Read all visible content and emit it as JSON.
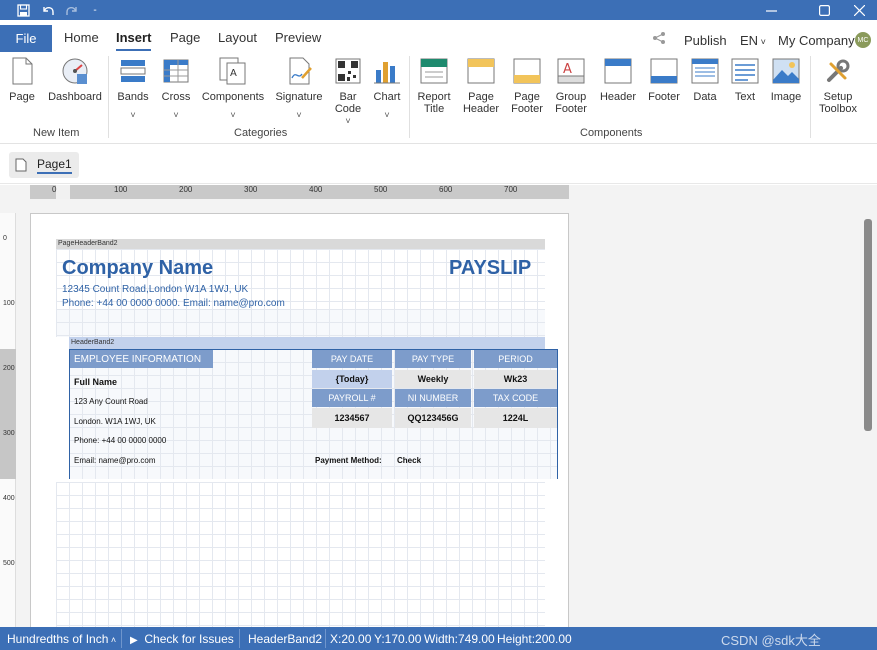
{
  "titlebar": {
    "save_icon": "save-icon",
    "undo_icon": "undo-icon",
    "redo_icon": "redo-icon",
    "separator": "-"
  },
  "tabs": {
    "file": "File",
    "items": [
      "Home",
      "Insert",
      "Page",
      "Layout",
      "Preview"
    ],
    "active": "Insert",
    "publish": "Publish",
    "language": "EN",
    "company": "My Company",
    "avatar": "MC"
  },
  "ribbon": {
    "new_item": {
      "label": "New Item",
      "items": [
        "Page",
        "Dashboard"
      ]
    },
    "categories": {
      "label": "Categories",
      "items": [
        "Bands",
        "Cross",
        "Components",
        "Signature",
        "Bar",
        "Code",
        "Chart"
      ]
    },
    "components": {
      "label": "Components",
      "items": [
        "Report",
        "Title",
        "Page",
        "Header",
        "Page",
        "Footer",
        "Group",
        "Footer",
        "Header",
        "Footer",
        "Data",
        "Text",
        "Image"
      ]
    },
    "setup": {
      "items": [
        "Setup",
        "Toolbox"
      ]
    }
  },
  "pagetab": {
    "label": "Page1"
  },
  "ruler": {
    "h_ticks": [
      "0",
      "100",
      "200",
      "300",
      "400",
      "500",
      "600",
      "700"
    ],
    "v_ticks": [
      "0",
      "100",
      "200",
      "300",
      "400",
      "500"
    ]
  },
  "report": {
    "page_header_band": "PageHeaderBand2",
    "header_band": "HeaderBand2",
    "company": "Company Name",
    "title": "PAYSLIP",
    "address": "12345 Count Road,London W1A 1WJ, UK",
    "contact": "Phone: +44 00 0000 0000. Email: name@pro.com",
    "employee": {
      "header": "EMPLOYEE INFORMATION",
      "lines": [
        "Full Name",
        "123 Any Count Road",
        "London. W1A 1WJ, UK",
        "Phone: +44 00 0000 0000",
        "Email: name@pro.com"
      ]
    },
    "table": {
      "row1_headers": [
        "PAY DATE",
        "PAY TYPE",
        "PERIOD"
      ],
      "row1_values": [
        "{Today}",
        "Weekly",
        "Wk23"
      ],
      "row2_headers": [
        "PAYROLL #",
        "NI NUMBER",
        "TAX CODE"
      ],
      "row2_values": [
        "1234567",
        "QQ123456G",
        "1224L"
      ]
    },
    "payment_method_label": "Payment Method:",
    "payment_method_value": "Check"
  },
  "statusbar": {
    "units": "Hundredths of Inch",
    "check": "Check for Issues",
    "selection": "HeaderBand2",
    "x": "X:20.00",
    "y": "Y:170.00",
    "width": "Width:749.00",
    "height": "Height:200.00",
    "watermark": "CSDN @sdk大全"
  },
  "colors": {
    "accent": "#3c6fb6",
    "report_blue": "#2f62a6",
    "header_cell": "#7d9ccb"
  }
}
